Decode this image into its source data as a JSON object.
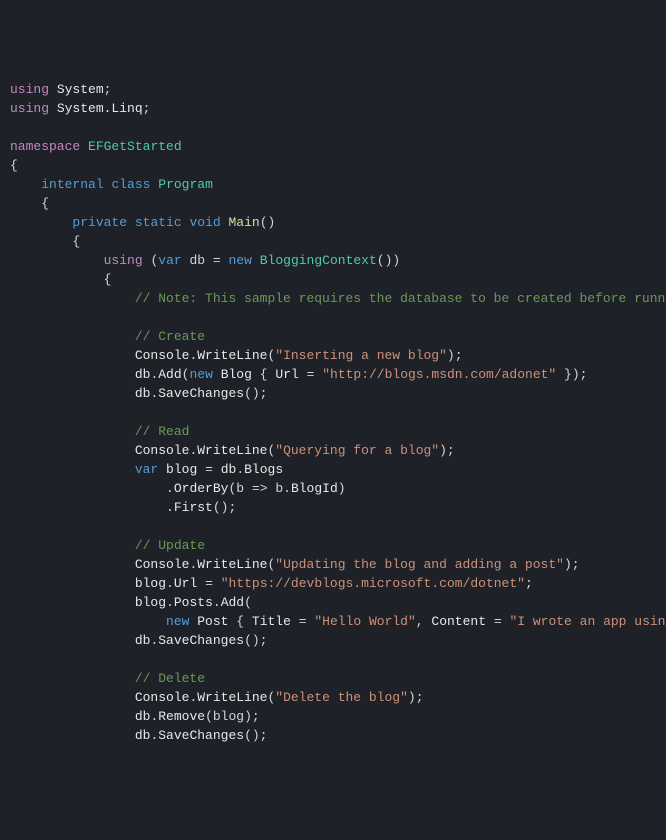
{
  "code": {
    "using1": "using",
    "using1_ns": "System",
    "using2": "using",
    "using2_ns": "System.Linq",
    "namespace_kw": "namespace",
    "namespace_name": "EFGetStarted",
    "internal_kw": "internal",
    "class_kw": "class",
    "class_name": "Program",
    "private_kw": "private",
    "static_kw": "static",
    "void_kw": "void",
    "main_name": "Main",
    "using_stmt": "using",
    "var_kw": "var",
    "db_var": "db",
    "new_kw": "new",
    "blogging_ctx": "BloggingContext",
    "comment_note": "// Note: This sample requires the database to be created before runni",
    "comment_create": "// Create",
    "console": "Console",
    "writeline": "WriteLine",
    "str_insert": "\"Inserting a new blog\"",
    "db": "db",
    "add": "Add",
    "blog_class": "Blog",
    "url_prop": "Url",
    "str_url1": "\"http://blogs.msdn.com/adonet\"",
    "savechanges": "SaveChanges",
    "comment_read": "// Read",
    "str_query": "\"Querying for a blog\"",
    "blog_var": "blog",
    "blogs_prop": "Blogs",
    "orderby": "OrderBy",
    "lambda_b": "b",
    "blogid": "BlogId",
    "first": "First",
    "comment_update": "// Update",
    "str_update": "\"Updating the blog and adding a post\"",
    "str_url2": "\"https://devblogs.microsoft.com/dotnet\"",
    "posts_prop": "Posts",
    "post_class": "Post",
    "title_prop": "Title",
    "str_hello": "\"Hello World\"",
    "content_prop": "Content",
    "str_wrote": "\"I wrote an app using",
    "comment_delete": "// Delete",
    "str_delete": "\"Delete the blog\"",
    "remove": "Remove"
  }
}
